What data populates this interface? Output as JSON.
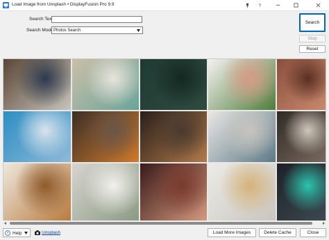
{
  "window": {
    "title": "Load Image from Unsplash • DisplayFusion Pro 9.9",
    "icon": "displayfusion-app-icon",
    "controls": [
      "pin-icon",
      "help-icon",
      "minimize-icon",
      "maximize-icon",
      "close-icon"
    ]
  },
  "form": {
    "search_text_label": "Search Text:",
    "search_text_value": "",
    "search_mode_label": "Search Mode:",
    "search_mode_value": "Photos Search"
  },
  "buttons": {
    "search": "Search",
    "stop": "Stop",
    "reset": "Reset",
    "load_more": "Load More Images",
    "delete_cache": "Delete Cache",
    "close": "Close"
  },
  "footer": {
    "help_label": "Help",
    "unsplash_label": "Unsplash"
  },
  "gallery": {
    "columns": 5,
    "rows": 3,
    "thumbnails": [
      {
        "subject": "laptop-on-wooden-desk",
        "colors": [
          "#5b4636",
          "#c7c3bb",
          "#2c3a4e"
        ]
      },
      {
        "subject": "aerial-beach-waves",
        "colors": [
          "#cbbfa8",
          "#6aa49a",
          "#e8e4dc"
        ]
      },
      {
        "subject": "aerial-forest-road",
        "colors": [
          "#1f3a33",
          "#2e4b3f",
          "#132822"
        ]
      },
      {
        "subject": "plant-in-pink-pot",
        "colors": [
          "#f4f2ef",
          "#4f7d3b",
          "#d79b84"
        ]
      },
      {
        "subject": "pink-fabric-abstract",
        "colors": [
          "#8a4f3c",
          "#c98a6e",
          "#5a2f24"
        ]
      },
      {
        "subject": "blue-tiled-house",
        "colors": [
          "#2e8fc4",
          "#8eb9d9",
          "#d9e4ec"
        ]
      },
      {
        "subject": "orange-chair-shadow",
        "colors": [
          "#3b2e27",
          "#d07a2c",
          "#6b5748"
        ]
      },
      {
        "subject": "city-street-night",
        "colors": [
          "#2a1f1a",
          "#b07a4a",
          "#4a3a30"
        ]
      },
      {
        "subject": "surface-laptop-desk",
        "colors": [
          "#e9e7e4",
          "#5e7a86",
          "#c8c4bf"
        ]
      },
      {
        "subject": "woman-with-coffee",
        "colors": [
          "#2f2a26",
          "#7a6a5e",
          "#cfc6bb"
        ]
      },
      {
        "subject": "cookies-on-table",
        "colors": [
          "#efe7dc",
          "#b77a3e",
          "#8e5a2b"
        ]
      },
      {
        "subject": "laptop-with-plants",
        "colors": [
          "#d7d4cf",
          "#8a9a82",
          "#f2f0ec"
        ]
      },
      {
        "subject": "couple-portrait",
        "colors": [
          "#3a1a1a",
          "#d69a7e",
          "#7a3a2e"
        ]
      },
      {
        "subject": "bright-bedroom",
        "colors": [
          "#ecebe7",
          "#c9c5bf",
          "#d6b37a"
        ]
      },
      {
        "subject": "smartwatch-dark",
        "colors": [
          "#1d2126",
          "#3e4a52",
          "#2bc4b0"
        ]
      }
    ]
  }
}
